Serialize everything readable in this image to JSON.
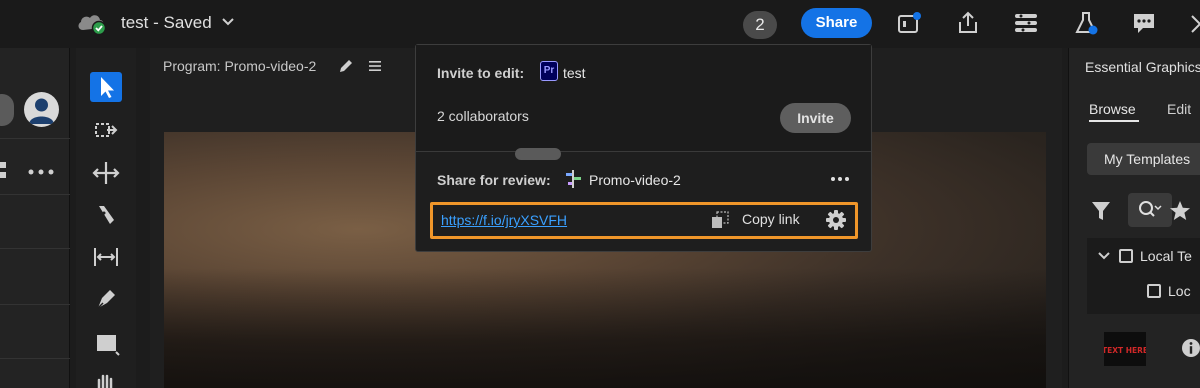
{
  "header": {
    "doc_title": "test - Saved",
    "collaborator_count": "2",
    "share_label": "Share",
    "icons": [
      "cloud-check-icon",
      "chevron-down-icon",
      "quick-export-icon",
      "export-icon",
      "workspaces-icon",
      "beta-flask-icon",
      "comments-icon"
    ]
  },
  "toolbar": {
    "tools": [
      "selection-tool-icon",
      "track-select-tool-icon",
      "ripple-edit-tool-icon",
      "razor-tool-icon",
      "slip-tool-icon",
      "pen-tool-icon",
      "rectangle-tool-icon",
      "hand-tool-icon"
    ]
  },
  "program_monitor": {
    "title": "Program: Promo-video-2"
  },
  "right_panel": {
    "title": "Essential Graphics",
    "tabs": [
      "Browse",
      "Edit"
    ],
    "active_tab": "Browse",
    "templates_dropdown": "My Templates",
    "tree": [
      {
        "label": "Local Te",
        "expanded": true
      },
      {
        "label": "Loc"
      }
    ],
    "thumbnail_text": "TEXT HERE"
  },
  "share_popover": {
    "invite_label": "Invite to edit:",
    "project_name": "test",
    "project_badge": "Pr",
    "collaborators_text": "2 collaborators",
    "invite_button": "Invite",
    "review_label": "Share for review:",
    "review_sequence": "Promo-video-2",
    "review_link": "https://f.io/jryXSVFH",
    "copy_link_label": "Copy link",
    "highlight_color": "#f0962a",
    "link_color": "#3aa0ff"
  },
  "colors": {
    "accent": "#1473e6",
    "background": "#1c1c1c"
  }
}
